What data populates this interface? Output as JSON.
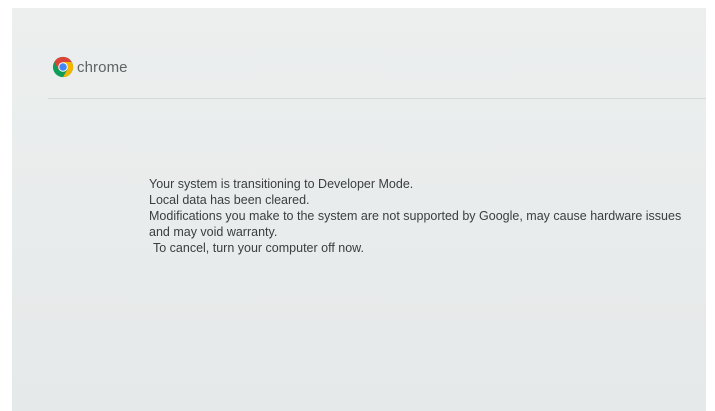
{
  "brand": {
    "wordmark": "chrome",
    "icon": "chrome-logo-icon",
    "colors": {
      "red": "#db4437",
      "yellow": "#f4b400",
      "green": "#0f9d58",
      "blue": "#4285f4"
    }
  },
  "message": {
    "line1": "Your system is transitioning to Developer Mode.",
    "line2": "Local data has been cleared.",
    "warning": "Modifications you make to the system are not supported by Google, may cause hardware issues and may void warranty.",
    "cancel": "To cancel, turn your computer off now."
  }
}
